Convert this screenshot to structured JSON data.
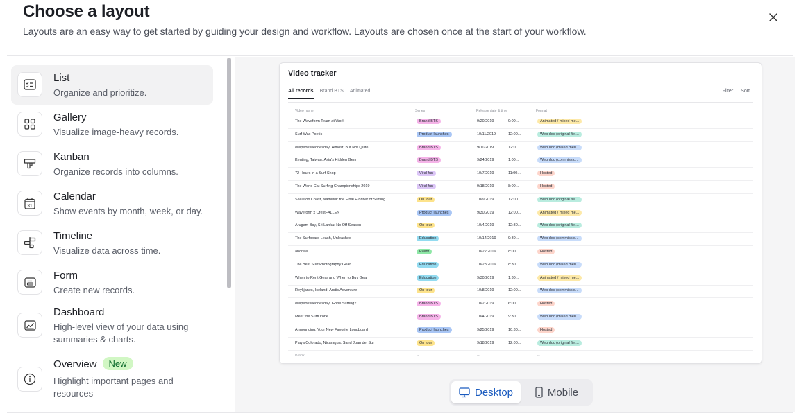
{
  "header": {
    "title": "Choose a layout",
    "subtitle": "Layouts are an easy way to get started by guiding your design and workflow. Layouts are chosen once at the start of your workflow."
  },
  "layouts": [
    {
      "name": "List",
      "desc": "Organize and prioritize.",
      "icon": "list-icon",
      "selected": true
    },
    {
      "name": "Gallery",
      "desc": "Visualize image-heavy records.",
      "icon": "gallery-icon"
    },
    {
      "name": "Kanban",
      "desc": "Organize records into columns.",
      "icon": "kanban-icon"
    },
    {
      "name": "Calendar",
      "desc": "Show events by month, week, or day.",
      "icon": "calendar-icon",
      "day": "31"
    },
    {
      "name": "Timeline",
      "desc": "Visualize data across time.",
      "icon": "timeline-icon"
    },
    {
      "name": "Form",
      "desc": "Create new records.",
      "icon": "form-icon"
    },
    {
      "name": "Dashboard",
      "desc": "High-level view of your data using summaries & charts.",
      "icon": "dashboard-icon"
    },
    {
      "name": "Overview",
      "badge": "New",
      "desc": "Highlight important pages and resources",
      "icon": "info-icon"
    }
  ],
  "preview": {
    "title": "Video tracker",
    "tabs": [
      "All records",
      "Brand BTS",
      "Animated"
    ],
    "actions": [
      "Filter",
      "Sort"
    ],
    "columns": [
      "Video name",
      "Series",
      "Release date & time",
      "Format"
    ],
    "rows": [
      {
        "name": "The Waveform Team at Work",
        "series": "Brand BTS",
        "date": "9/20/2019",
        "time": "9:00...",
        "format": "Animated / mixed me..."
      },
      {
        "name": "Surf Wax Poetic",
        "series": "Product launches",
        "date": "10/11/2019",
        "time": "12:00...",
        "format": "Web doc (original fiel..."
      },
      {
        "name": "#wipeoutwednesday: Almost, But Not Quite",
        "series": "Brand BTS",
        "date": "9/11/2019",
        "time": "12:0...",
        "format": "Web doc (mixed med..."
      },
      {
        "name": "Kenting, Taiwan: Asia's Hidden Gem",
        "series": "Brand BTS",
        "date": "9/24/2019",
        "time": "1:00...",
        "format": "Web doc (commissio..."
      },
      {
        "name": "72 Hours in a Surf Shop",
        "series": "Viral fun",
        "date": "10/7/2019",
        "time": "11:00...",
        "format": "Hosted"
      },
      {
        "name": "The World Cat Surfing Championships 2019",
        "series": "Viral fun",
        "date": "9/18/2019",
        "time": "8:00...",
        "format": "Hosted"
      },
      {
        "name": "Skeleton Coast, Namibia: the Final Frontier of Surfing",
        "series": "On tour",
        "date": "10/9/2019",
        "time": "12:00...",
        "format": "Web doc (original fiel..."
      },
      {
        "name": "Waveform x CrestFALLEN",
        "series": "Product launches",
        "date": "9/30/2019",
        "time": "12:00...",
        "format": "Animated / mixed me..."
      },
      {
        "name": "Arugam Bay, Sri Lanka: No Off Season",
        "series": "On tour",
        "date": "10/4/2019",
        "time": "12:30...",
        "format": "Web doc (original fiel..."
      },
      {
        "name": "The Surfboard Leash, Unleashed",
        "series": "Education",
        "date": "10/14/2019",
        "time": "9:30...",
        "format": "Web doc (commissio..."
      },
      {
        "name": "andrew",
        "series": "Event",
        "date": "10/22/2019",
        "time": "8:00...",
        "format": "Hosted"
      },
      {
        "name": "The Best Surf Photography Gear",
        "series": "Education",
        "date": "10/28/2019",
        "time": "8:30...",
        "format": "Web doc (mixed med..."
      },
      {
        "name": "When to Rent Gear and When to Buy Gear",
        "series": "Education",
        "date": "9/30/2019",
        "time": "1:30...",
        "format": "Animated / mixed me..."
      },
      {
        "name": "Reykjanes, Iceland: Arctic Adventure",
        "series": "On tour",
        "date": "10/8/2019",
        "time": "12:00...",
        "format": "Web doc (commissio..."
      },
      {
        "name": "#wipeoutwednesday: Gone Surfing?",
        "series": "Brand BTS",
        "date": "10/2/2019",
        "time": "6:00...",
        "format": "Hosted"
      },
      {
        "name": "Meet the SurfDrone",
        "series": "Brand BTS",
        "date": "10/4/2019",
        "time": "9:30...",
        "format": "Web doc (mixed med..."
      },
      {
        "name": "Announcing: Your New Favorite Longboard",
        "series": "Product launches",
        "date": "9/25/2019",
        "time": "10:30...",
        "format": "Hosted"
      },
      {
        "name": "Playa Colorado, Nicaragua: Sand Juan del Sur",
        "series": "On tour",
        "date": "9/18/2019",
        "time": "12:00...",
        "format": "Web doc (original fiel..."
      },
      {
        "name": "Blank...",
        "series": "--",
        "date": "--",
        "time": "",
        "format": "--"
      }
    ],
    "series_colors": {
      "Brand BTS": "#f5b3e8",
      "Product launches": "#a9c6f5",
      "Viral fun": "#dcc6f7",
      "On tour": "#fde38b",
      "Education": "#93dbf0",
      "Event": "#8ee7a6"
    },
    "format_colors": {
      "Animated / mixed me...": "#fde9a8",
      "Web doc (original fiel...": "#b9ecdf",
      "Web doc (mixed med...": "#c8dcfa",
      "Web doc (commissio...": "#c8dcfa",
      "Hosted": "#fdd5cb"
    }
  },
  "view_toggle": {
    "desktop_label": "Desktop",
    "mobile_label": "Mobile",
    "active": "Desktop",
    "accent": "#1a5bbf"
  }
}
